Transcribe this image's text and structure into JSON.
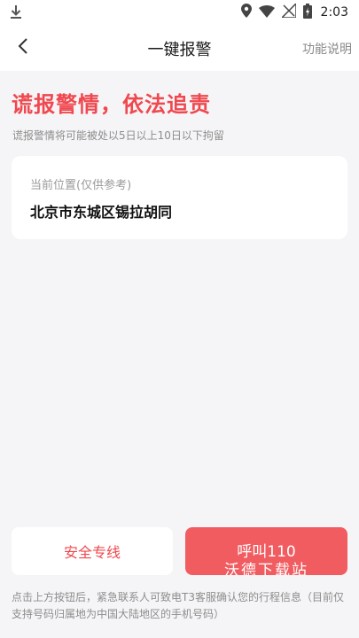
{
  "status_bar": {
    "time": "2:03",
    "icons": [
      "download-icon",
      "location-icon",
      "wifi-icon",
      "signal-icon",
      "battery-icon"
    ]
  },
  "nav": {
    "title": "一键报警",
    "right_action": "功能说明"
  },
  "warning": {
    "title": "谎报警情，依法追责",
    "subtitle": "谎报警情将可能被处以5日以上10日以下拘留"
  },
  "location": {
    "label": "当前位置(仅供参考)",
    "value": "北京市东城区锡拉胡同"
  },
  "buttons": {
    "safety_label": "安全专线",
    "call_label": "呼叫110"
  },
  "watermark": "沃德下载站",
  "footer_note": "点击上方按钮后，紧急联系人可致电T3客服确认您的行程信息（目前仅支持号码归属地为中国大陆地区的手机号码）",
  "colors": {
    "accent": "#f0484e",
    "call_button": "#f15c60",
    "background": "#f5f5f7"
  }
}
